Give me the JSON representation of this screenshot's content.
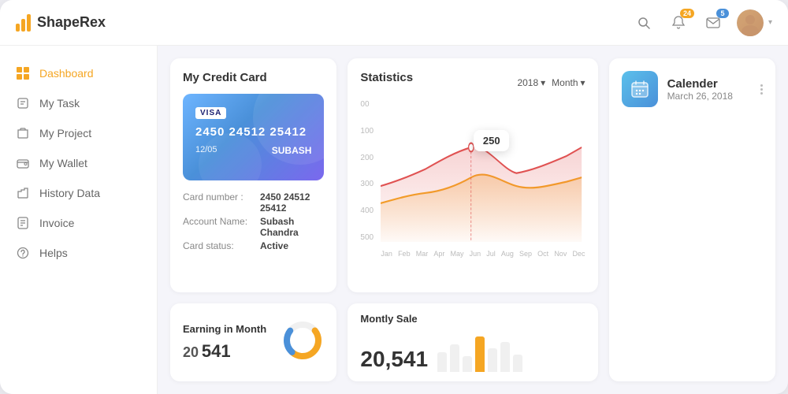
{
  "app": {
    "name": "ShapeRex"
  },
  "topbar": {
    "search_title": "Search",
    "notification_count": "24",
    "mail_count": "5"
  },
  "sidebar": {
    "items": [
      {
        "id": "dashboard",
        "label": "Dashboard",
        "active": true
      },
      {
        "id": "my-task",
        "label": "My Task",
        "active": false
      },
      {
        "id": "my-project",
        "label": "My Project",
        "active": false
      },
      {
        "id": "my-wallet",
        "label": "My Wallet",
        "active": false
      },
      {
        "id": "history-data",
        "label": "History Data",
        "active": false
      },
      {
        "id": "invoice",
        "label": "Invoice",
        "active": false
      },
      {
        "id": "helps",
        "label": "Helps",
        "active": false
      }
    ]
  },
  "credit_card": {
    "section_title": "My Credit Card",
    "visa_label": "VISA",
    "number": "2450  24512  25412",
    "expiry": "12/05",
    "holder": "SUBASH",
    "card_number_label": "Card number :",
    "card_number_value": "2450 24512 25412",
    "account_name_label": "Account Name:",
    "account_name_value": "Subash Chandra",
    "card_status_label": "Card status:",
    "card_status_value": "Active"
  },
  "statistics": {
    "title": "Statistics",
    "year": "2018",
    "period": "Month",
    "tooltip_value": "250",
    "y_labels": [
      "500",
      "400",
      "300",
      "200",
      "100",
      "00"
    ],
    "x_labels": [
      "Jan",
      "Feb",
      "Mar",
      "Apr",
      "May",
      "Jun",
      "Jul",
      "Aug",
      "Sep",
      "Oct",
      "Nov",
      "Dec"
    ]
  },
  "earning": {
    "title": "Earning in Month",
    "amount": "20,541"
  },
  "monthly_sale": {
    "title": "Montly Sale",
    "amount": "20,541"
  },
  "calendar": {
    "title": "Calender",
    "date": "March 26, 2018"
  }
}
